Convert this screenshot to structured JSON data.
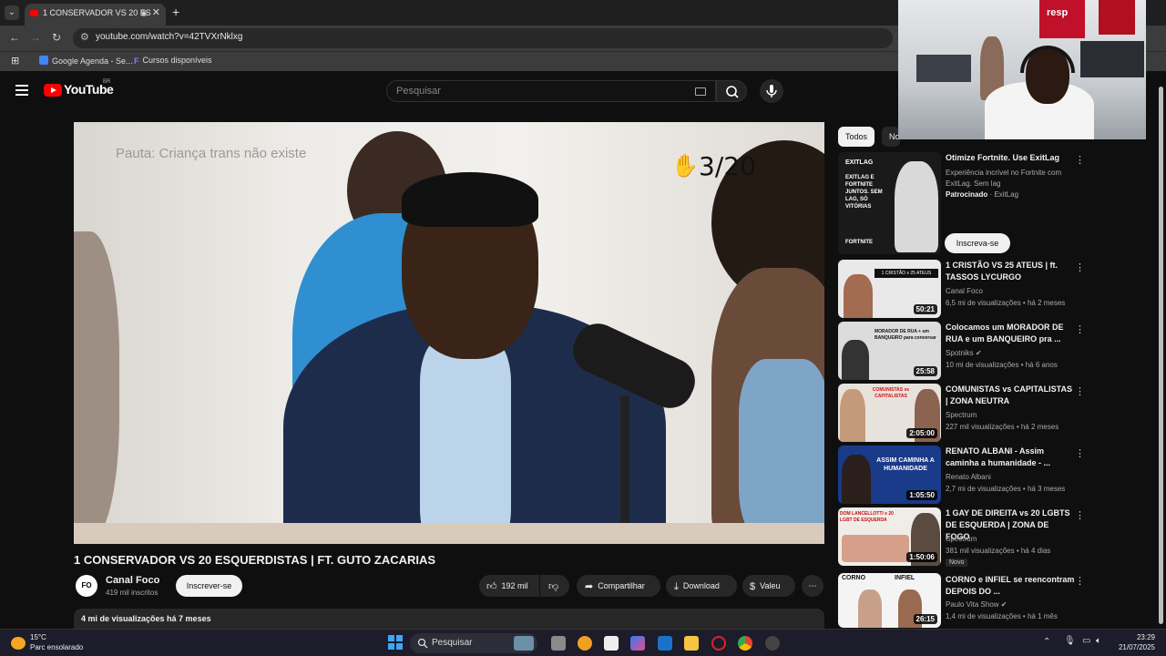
{
  "browser": {
    "tab_title": "1 CONSERVADOR VS 20 ES",
    "url": "youtube.com/watch?v=42TVXrNklxg",
    "bookmarks": [
      "Google Agenda - Se...",
      "Cursos disponíveis"
    ]
  },
  "header": {
    "logo": "YouTube",
    "country": "BR",
    "search_placeholder": "Pesquisar"
  },
  "video": {
    "overlay_topic": "Pauta: Criança trans não existe",
    "overlay_counter": "3/20",
    "title": "1 CONSERVADOR VS 20 ESQUERDISTAS | FT. GUTO ZACARIAS",
    "channel": "Canal Foco",
    "channel_initials": "FO",
    "subscribers": "419 mil inscritos",
    "subscribe_label": "Inscrever-se",
    "likes": "192 mil",
    "share_label": "Compartilhar",
    "download_label": "Download",
    "thanks_label": "Valeu",
    "views_time": "4 mi de visualizações  há 7 meses"
  },
  "sidebar": {
    "chips": [
      "Todos",
      "No"
    ],
    "ad": {
      "title": "Otimize Fortnite. Use ExitLag",
      "desc": "Experiência incrível no Fortnite com ExitLag. Sem lag",
      "sponsored": "Patrocinado",
      "advertiser": "ExitLag",
      "cta": "Inscreva-se",
      "thumb_brand": "EXITLAG",
      "thumb_text": "EXITLAG E FORTNITE JUNTOS. SEM LAG, SÓ VITÓRIAS",
      "thumb_game": "FORTNITE"
    },
    "items": [
      {
        "title": "1 CRISTÃO VS 25 ATEUS | ft. TASSOS LYCURGO",
        "channel": "Canal Foco",
        "meta": "6,5 mi de visualizações • há 2 meses",
        "duration": "50:21",
        "thumb_text": "1 CRISTÃO x 25 ATEUS"
      },
      {
        "title": "Colocamos um MORADOR DE RUA e um BANQUEIRO pra ...",
        "channel": "Spotniks",
        "meta": "10 mi de visualizações • há 6 anos",
        "duration": "25:58",
        "thumb_text": "MORADOR DE RUA + um BANQUEIRO para conversar"
      },
      {
        "title": "COMUNISTAS vs CAPITALISTAS | ZONA NEUTRA",
        "channel": "Spectrum",
        "meta": "227 mil visualizações • há 2 meses",
        "duration": "2:05:00",
        "thumb_text": "COMUNISTAS vs CAPITALISTAS"
      },
      {
        "title": "RENATO ALBANI - Assim caminha a humanidade - ...",
        "channel": "Renato Albani",
        "meta": "2,7 mi de visualizações • há 3 meses",
        "duration": "1:05:50",
        "thumb_text": "ASSIM CAMINHA A HUMANIDADE"
      },
      {
        "title": "1 GAY DE DIREITA vs 20 LGBTS DE ESQUERDA | ZONA DE FOGO",
        "channel": "Spectrum",
        "meta": "381 mil visualizações • há 4 dias",
        "duration": "1:50:06",
        "badge": "Novo",
        "thumb_text": "DOM LANCELLOTTI x 20 LGBT DE ESQUERDA"
      },
      {
        "title": "CORNO e INFIEL se reencontram DEPOIS DO ...",
        "channel": "Paulo Vita Show",
        "meta": "1,4 mi de visualizações • há 1 mês",
        "duration": "26:15",
        "thumb_text": "CORNO  INFIEL"
      }
    ]
  },
  "taskbar": {
    "temp": "15°C",
    "weather": "Parc ensolarado",
    "search": "Pesquisar",
    "time": "23:29",
    "date": "21/07/2025"
  },
  "webcam": {
    "sign": "resp"
  }
}
